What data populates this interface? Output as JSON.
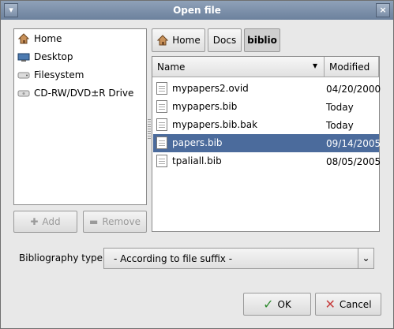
{
  "window": {
    "title": "Open file"
  },
  "places": [
    {
      "label": "Home",
      "icon": "home-icon"
    },
    {
      "label": "Desktop",
      "icon": "desktop-icon"
    },
    {
      "label": "Filesystem",
      "icon": "drive-icon"
    },
    {
      "label": "CD-RW/DVD±R Drive",
      "icon": "optical-drive-icon"
    }
  ],
  "buttons": {
    "add": "Add",
    "remove": "Remove",
    "ok": "OK",
    "cancel": "Cancel"
  },
  "path": [
    {
      "label": "Home"
    },
    {
      "label": "Docs"
    },
    {
      "label": "biblio"
    }
  ],
  "files": {
    "headers": {
      "name": "Name",
      "modified": "Modified"
    },
    "rows": [
      {
        "name": "mypapers2.ovid",
        "modified": "04/20/2000",
        "selected": false
      },
      {
        "name": "mypapers.bib",
        "modified": "Today",
        "selected": false
      },
      {
        "name": "mypapers.bib.bak",
        "modified": "Today",
        "selected": false
      },
      {
        "name": "papers.bib",
        "modified": "09/14/2005",
        "selected": true
      },
      {
        "name": "tpaliall.bib",
        "modified": "08/05/2005",
        "selected": false
      }
    ]
  },
  "bibliography": {
    "label": "Bibliography type:",
    "value": "- According to file suffix -"
  }
}
